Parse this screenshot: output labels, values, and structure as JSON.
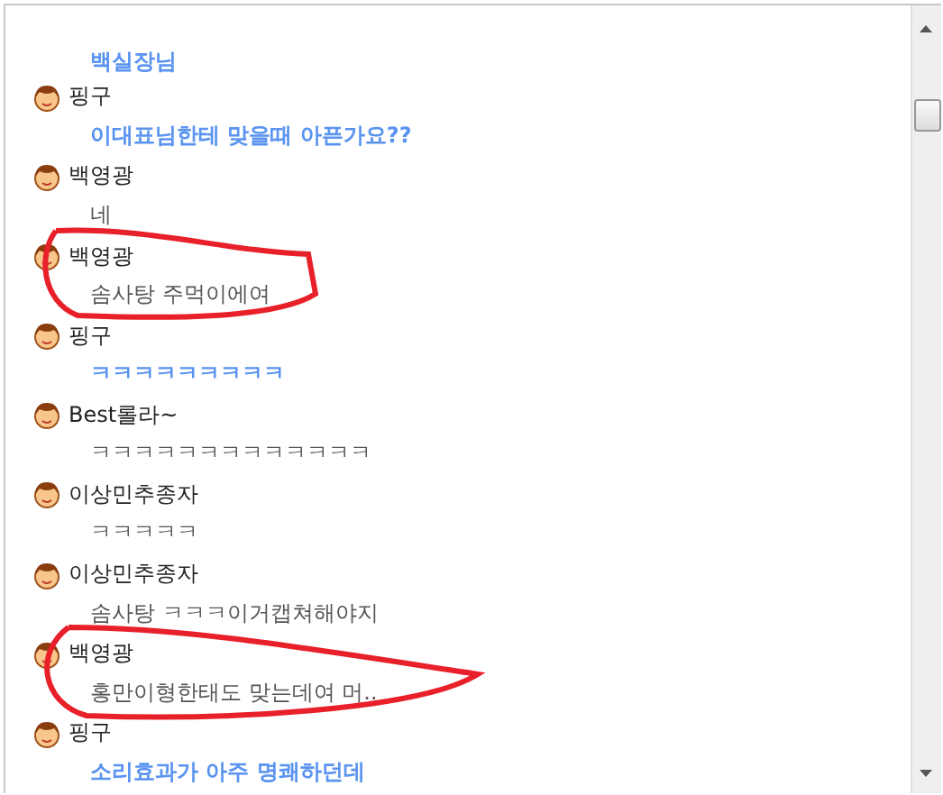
{
  "messages": [
    {
      "text": "백실장님",
      "kind": "emphasized",
      "circled": false
    },
    {
      "name": "핑구",
      "text": "이대표님한테 맞을때 아픈가요??",
      "kind": "emphasized",
      "circled": false
    },
    {
      "name": "백영광",
      "text": "네",
      "kind": "plain",
      "circled": false
    },
    {
      "name": "백영광",
      "text": "솜사탕 주먹이에여",
      "kind": "plain",
      "circled": true
    },
    {
      "name": "핑구",
      "text": "ㅋㅋㅋㅋㅋㅋㅋㅋㅋ",
      "kind": "emphasized",
      "circled": false
    },
    {
      "name": "Best롤라~",
      "text": "ㅋㅋㅋㅋㅋㅋㅋㅋㅋㅋㅋㅋㅋ",
      "kind": "plain",
      "circled": false
    },
    {
      "name": "이상민추종자",
      "text": "ㅋㅋㅋㅋㅋ",
      "kind": "plain",
      "circled": false
    },
    {
      "name": "이상민추종자",
      "text": "솜사탕 ㅋㅋㅋ이거캡쳐해야지",
      "kind": "plain",
      "circled": false
    },
    {
      "name": "백영광",
      "text": "홍만이형한태도 맞는데여 머..",
      "kind": "plain",
      "circled": true
    },
    {
      "name": "핑구",
      "text": "소리효과가 아주 명쾌하던데",
      "kind": "emphasized",
      "circled": false
    }
  ]
}
